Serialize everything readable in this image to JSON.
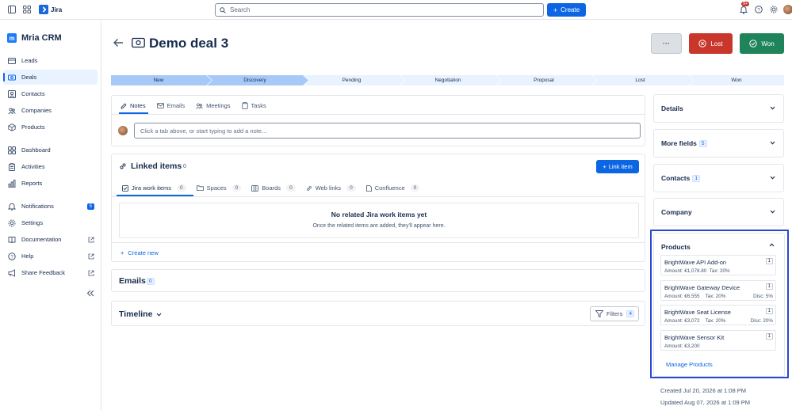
{
  "topbar": {
    "app_name": "Jira",
    "search_placeholder": "Search",
    "create_label": "Create",
    "notifications_badge": "9+"
  },
  "sidebar": {
    "project_name": "Mria CRM",
    "items": [
      {
        "label": "Leads"
      },
      {
        "label": "Deals"
      },
      {
        "label": "Contacts"
      },
      {
        "label": "Companies"
      },
      {
        "label": "Products"
      },
      {
        "label": "Dashboard"
      },
      {
        "label": "Activities"
      },
      {
        "label": "Reports"
      },
      {
        "label": "Notifications",
        "badge": "5"
      },
      {
        "label": "Settings"
      },
      {
        "label": "Documentation"
      },
      {
        "label": "Help"
      },
      {
        "label": "Share Feedback"
      }
    ]
  },
  "deal": {
    "title": "Demo deal 3",
    "more_label": "···",
    "lost_label": "Lost",
    "won_label": "Won"
  },
  "pipeline": {
    "stages": [
      "New",
      "Discovery",
      "Pending",
      "Negotiation",
      "Proposal",
      "Lost",
      "Won"
    ],
    "current_index": 1
  },
  "activity_tabs": {
    "tabs": [
      "Notes",
      "Emails",
      "Meetings",
      "Tasks"
    ],
    "note_placeholder": "Click a tab above, or start typing to add a note..."
  },
  "linked_items": {
    "title": "Linked items",
    "count": "0",
    "link_button": "Link item",
    "tabs": [
      {
        "label": "Jira work items",
        "count": "0"
      },
      {
        "label": "Spaces",
        "count": "0"
      },
      {
        "label": "Boards",
        "count": "0"
      },
      {
        "label": "Web links",
        "count": "0"
      },
      {
        "label": "Confluence",
        "count": "0"
      }
    ],
    "empty_title": "No related Jira work items yet",
    "empty_desc": "Once the related items are added, they'll appear here.",
    "create_new": "Create new"
  },
  "emails": {
    "title": "Emails",
    "count": "0"
  },
  "timeline": {
    "title": "Timeline",
    "filters_label": "Filters",
    "filters_count": "4"
  },
  "right_panel": {
    "details": "Details",
    "more_fields": "More fields",
    "more_fields_count": "5",
    "contacts": "Contacts",
    "contacts_count": "1",
    "company": "Company",
    "products_title": "Products",
    "products": [
      {
        "name": "BrightWave API Add-on",
        "amount": "Amount: €1,078.80",
        "tax": "Tax: 20%",
        "disc": "",
        "qty": "1"
      },
      {
        "name": "BrightWave Gateway Device",
        "amount": "Amount: €6,555",
        "tax": "Tax: 20%",
        "disc": "Disc: 5%",
        "qty": "1"
      },
      {
        "name": "BrightWave Seat License",
        "amount": "Amount: €3,072",
        "tax": "Tax: 20%",
        "disc": "Disc: 20%",
        "qty": "1"
      },
      {
        "name": "BrightWave Sensor Kit",
        "amount": "Amount: €3,200",
        "tax": "",
        "disc": "",
        "qty": "1"
      }
    ],
    "manage_products": "Manage Products",
    "created": "Created Jul 20, 2026 at 1:08 PM",
    "updated": "Updated Aug 07, 2026 at 1:09 PM"
  },
  "colors": {
    "accent": "#0c66e4",
    "lost": "#c9372c",
    "won": "#1f845a",
    "stage_done": "#a7c9f8",
    "stage_todo": "#e9f2ff"
  }
}
